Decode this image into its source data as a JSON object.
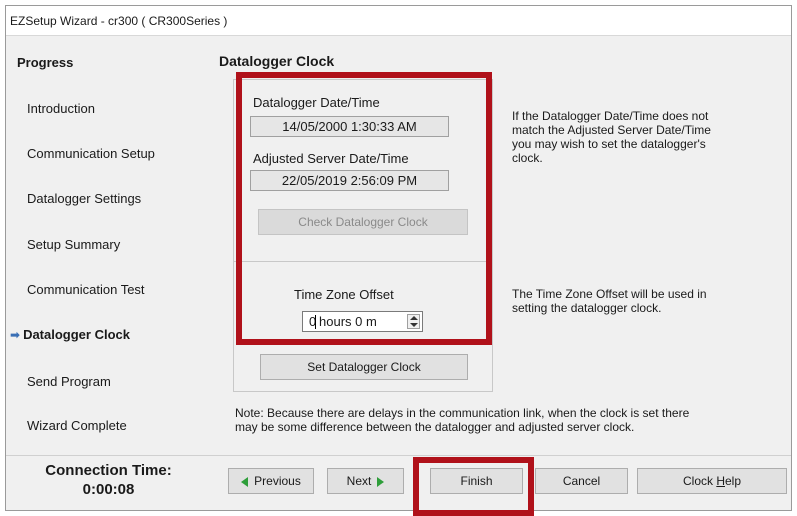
{
  "window": {
    "title": "EZSetup Wizard - cr300 ( CR300Series )"
  },
  "sidebar": {
    "heading": "Progress",
    "items": [
      {
        "label": "Introduction"
      },
      {
        "label": "Communication Setup"
      },
      {
        "label": "Datalogger Settings"
      },
      {
        "label": "Setup Summary"
      },
      {
        "label": "Communication Test"
      },
      {
        "label": "Datalogger Clock",
        "current": true
      },
      {
        "label": "Send Program"
      },
      {
        "label": "Wizard Complete"
      }
    ],
    "connection_label": "Connection Time:",
    "connection_value": "0:00:08"
  },
  "main": {
    "section_title": "Datalogger Clock",
    "datalogger_label": "Datalogger Date/Time",
    "datalogger_value": "14/05/2000 1:30:33 AM",
    "server_label": "Adjusted Server Date/Time",
    "server_value": "22/05/2019 2:56:09 PM",
    "check_button": "Check Datalogger Clock",
    "info_clock": [
      "If the Datalogger Date/Time does not",
      "match the Adjusted Server Date/Time",
      "you may wish to set the datalogger's",
      "clock."
    ],
    "tz_label": "Time Zone Offset",
    "tz_hours_value": "0",
    "tz_rest": "hours 0 m",
    "info_tz": [
      "The Time Zone Offset will be used in",
      "setting the datalogger clock."
    ],
    "set_button": "Set Datalogger Clock",
    "note": [
      "Note: Because there are delays in the communication link, when the clock is set there",
      "may be some difference between the datalogger and adjusted server clock."
    ]
  },
  "footer": {
    "previous": "Previous",
    "next": "Next",
    "finish": "Finish",
    "cancel": "Cancel",
    "help_prefix": "Clock ",
    "help_mnemonic": "H",
    "help_suffix": "elp"
  },
  "colors": {
    "highlight": "#b0111a",
    "nav_arrow": "#2e9e3a",
    "current_marker": "#3a6fb5"
  }
}
